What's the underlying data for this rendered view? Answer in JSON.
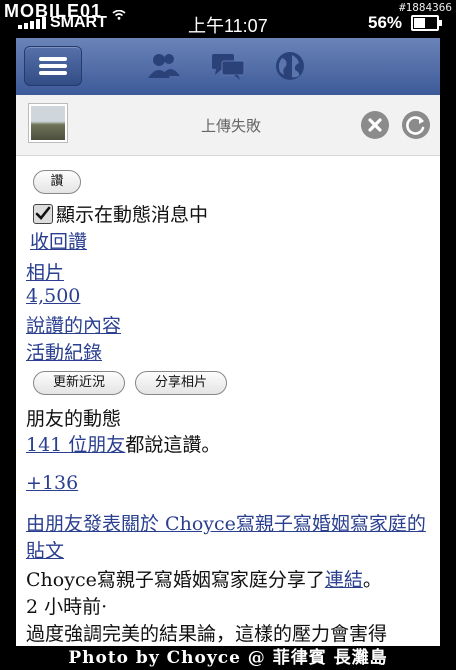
{
  "watermark": {
    "left": "MOBILE01",
    "right": "#1884366"
  },
  "status_bar": {
    "carrier": "SMART",
    "time": "上午11:07",
    "battery_percent": "56%",
    "battery_level": 0.56
  },
  "fb_nav": {
    "menu_icon": "menu-icon",
    "friends_icon": "friends-icon",
    "messages_icon": "messages-icon",
    "notifications_icon": "globe-icon"
  },
  "upload": {
    "status_text": "上傳失敗"
  },
  "post": {
    "like_button": "讚",
    "show_in_feed": "顯示在動態消息中",
    "unlike_link": "收回讚",
    "photos_link": "相片",
    "count_link": "4,500",
    "likers_link": "說讚的內容",
    "activity_link": "活動紀錄",
    "update_status_button": "更新近況",
    "share_photo_button": "分享相片",
    "friends_activity_title": "朋友的動態",
    "friends_like_link": "141 位朋友",
    "friends_like_suffix": "都說這讚。",
    "more_link": "+136",
    "friend_post_link": "由朋友發表關於 Choyce寫親子寫婚姻寫家庭的貼文",
    "share_line_prefix": "Choyce寫親子寫婚姻寫家庭分享了",
    "share_line_link": "連結",
    "share_line_suffix": "。",
    "time_ago": "2 小時前·",
    "excerpt": "過度強調完美的結果論，這樣的壓力會害得"
  },
  "caption": "Photo by Choyce @ 菲律賓 長灘島"
}
